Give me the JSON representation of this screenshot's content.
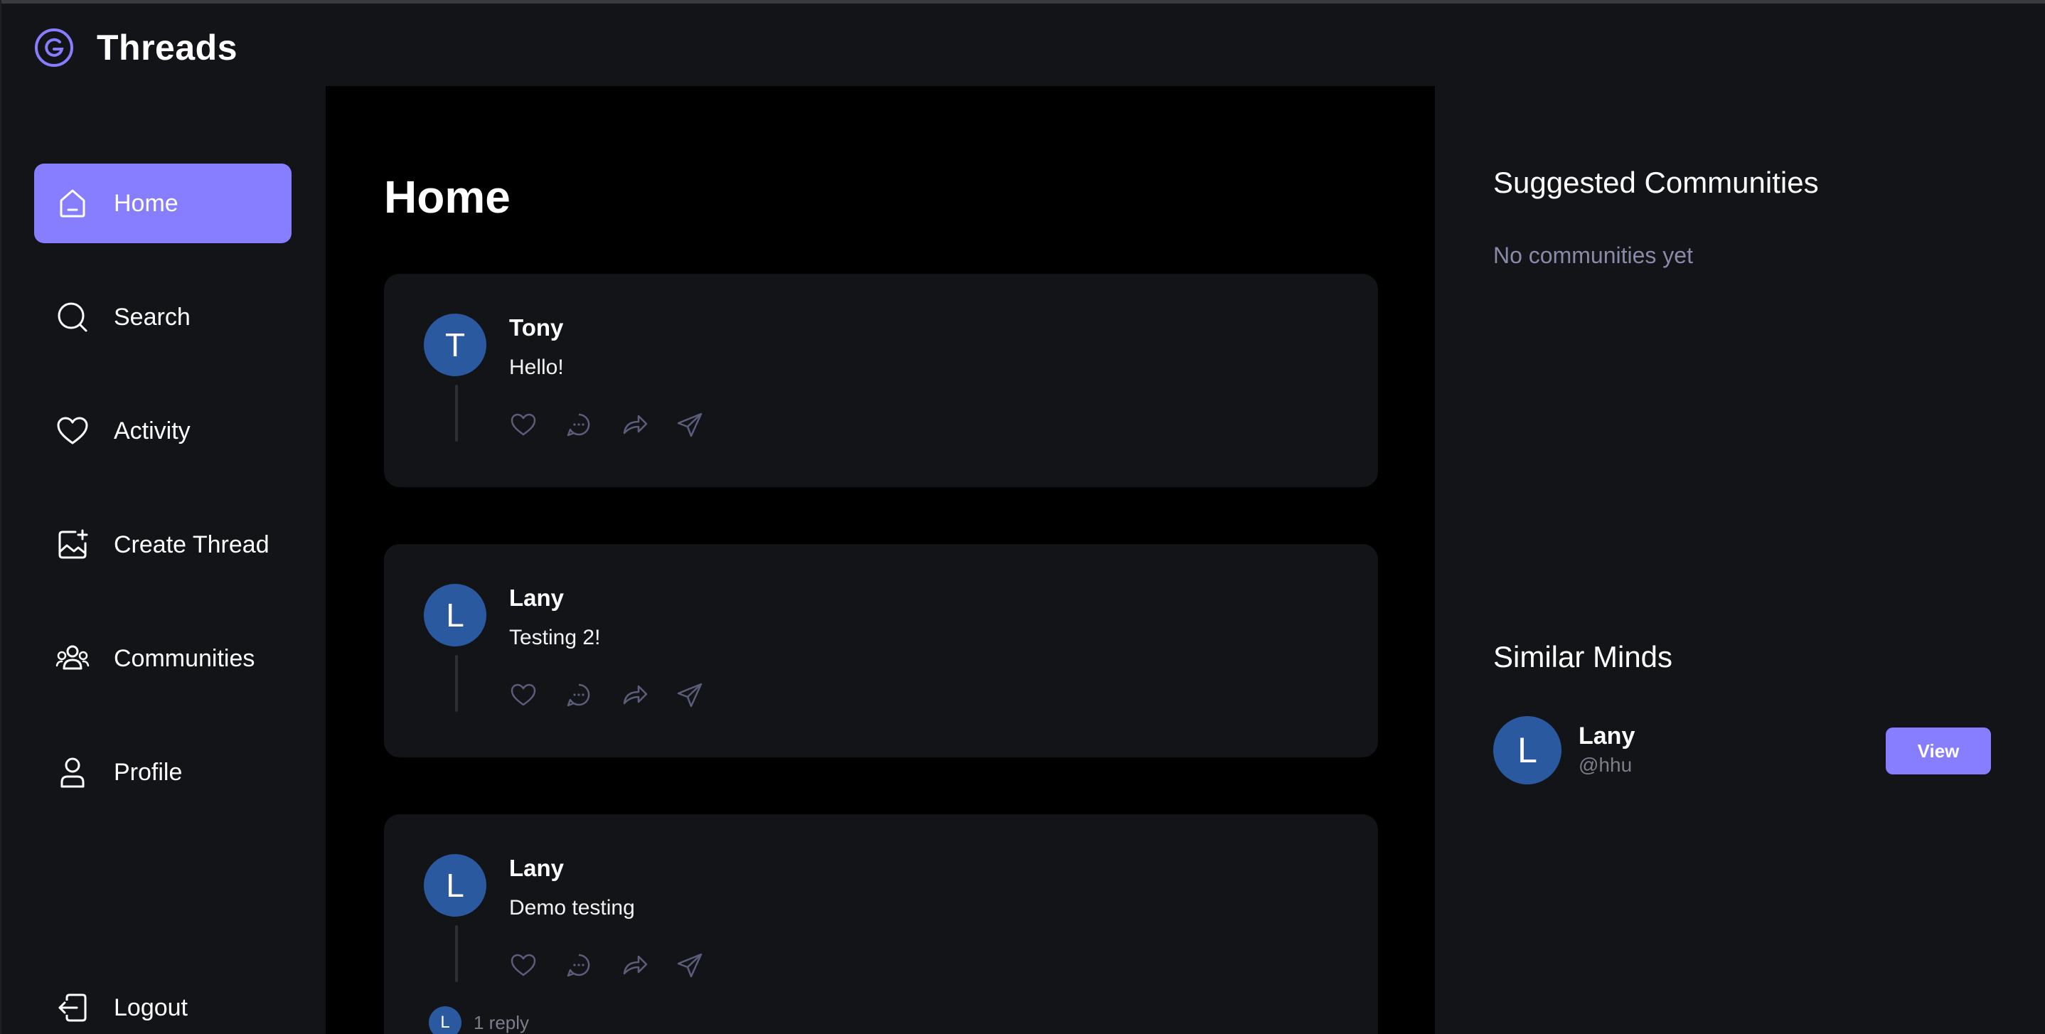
{
  "app": {
    "brand": "Threads"
  },
  "colors": {
    "accent": "#877eff",
    "avatar": "#2a59a0",
    "background": "#121417",
    "feed_background": "#000000"
  },
  "sidebar": {
    "items": [
      {
        "label": "Home",
        "icon": "home-icon",
        "active": true
      },
      {
        "label": "Search",
        "icon": "search-icon",
        "active": false
      },
      {
        "label": "Activity",
        "icon": "heart-icon",
        "active": false
      },
      {
        "label": "Create Thread",
        "icon": "image-plus-icon",
        "active": false
      },
      {
        "label": "Communities",
        "icon": "users-icon",
        "active": false
      },
      {
        "label": "Profile",
        "icon": "user-icon",
        "active": false
      }
    ],
    "logout": {
      "label": "Logout",
      "icon": "logout-icon"
    }
  },
  "main": {
    "title": "Home",
    "threads": [
      {
        "avatar_letter": "T",
        "author": "Tony",
        "content": "Hello!"
      },
      {
        "avatar_letter": "L",
        "author": "Lany",
        "content": "Testing 2!"
      },
      {
        "avatar_letter": "L",
        "author": "Lany",
        "content": "Demo testing",
        "reply_avatar_letter": "L",
        "reply_count": "1 reply"
      }
    ]
  },
  "right": {
    "communities": {
      "title": "Suggested Communities",
      "empty": "No communities yet"
    },
    "similar": {
      "title": "Similar Minds",
      "users": [
        {
          "avatar_letter": "L",
          "name": "Lany",
          "handle": "@hhu",
          "button": "View"
        }
      ]
    }
  }
}
